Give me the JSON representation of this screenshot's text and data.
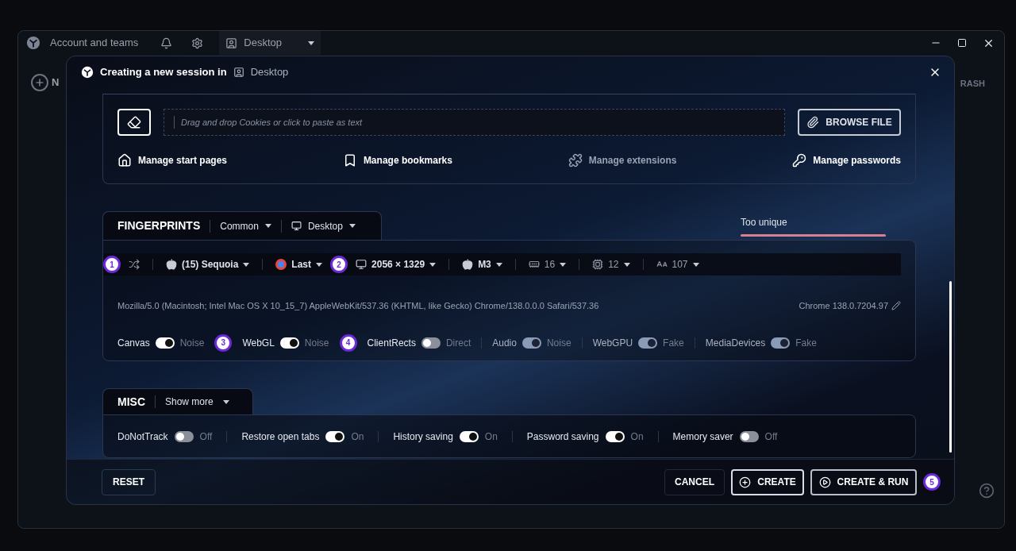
{
  "title_bar": {
    "account": "Account and teams",
    "workspace": "Desktop"
  },
  "sidebar": {
    "new_label": "N"
  },
  "right_panel": {
    "label": "RASH"
  },
  "dialog": {
    "title": "Creating a new session in",
    "workspace": "Desktop"
  },
  "cookies": {
    "placeholder": "Drag and drop Cookies or click to paste as text",
    "browse": "BROWSE FILE"
  },
  "manage_links": [
    {
      "kind": "home",
      "label": "Manage start pages",
      "disabled": false
    },
    {
      "kind": "bookmark",
      "label": "Manage bookmarks",
      "disabled": false
    },
    {
      "kind": "puzzle",
      "label": "Manage extensions",
      "disabled": true
    },
    {
      "kind": "key",
      "label": "Manage passwords",
      "disabled": false
    }
  ],
  "fingerprints": {
    "title": "FINGERPRINTS",
    "preset": "Common",
    "device": "Desktop",
    "score_label": "Too unique",
    "score": {
      "level": 1
    },
    "toolbar": [
      {
        "kind": "apple",
        "label": "(15) Sequoia"
      },
      {
        "kind": "chrome",
        "label": "Last"
      },
      {
        "kind": "monitor",
        "label": "2056 × 1329"
      },
      {
        "kind": "apple",
        "label": "M3"
      },
      {
        "kind": "memory",
        "label": "16"
      },
      {
        "kind": "cpu",
        "label": "12"
      },
      {
        "kind": "font",
        "label": "107"
      }
    ],
    "user_agent": "Mozilla/5.0 (Macintosh; Intel Mac OS X 10_15_7) AppleWebKit/537.36 (KHTML, like Gecko) Chrome/138.0.0.0 Safari/537.36",
    "browser_version": "Chrome 138.0.7204.97",
    "toggles": [
      {
        "label": "Canvas",
        "on": true,
        "disabled": false,
        "value": "Noise",
        "annotation": "3"
      },
      {
        "label": "WebGL",
        "on": true,
        "disabled": false,
        "value": "Noise",
        "annotation": "4"
      },
      {
        "label": "ClientRects",
        "on": false,
        "disabled": false,
        "value": "Direct"
      },
      {
        "label": "Audio",
        "on": true,
        "disabled": true,
        "value": "Noise"
      },
      {
        "label": "WebGPU",
        "on": true,
        "disabled": true,
        "value": "Fake"
      },
      {
        "label": "MediaDevices",
        "on": true,
        "disabled": true,
        "value": "Fake"
      }
    ]
  },
  "misc": {
    "title": "MISC",
    "show_more": "Show more",
    "toggles": [
      {
        "label": "DoNotTrack",
        "on": false,
        "value": "Off"
      },
      {
        "label": "Restore open tabs",
        "on": true,
        "value": "On"
      },
      {
        "label": "History saving",
        "on": true,
        "value": "On"
      },
      {
        "label": "Password saving",
        "on": true,
        "value": "On"
      },
      {
        "label": "Memory saver",
        "on": false,
        "value": "Off"
      }
    ]
  },
  "footer": {
    "reset": "RESET",
    "cancel": "CANCEL",
    "create": "CREATE",
    "create_run": "CREATE & RUN"
  },
  "annotations": [
    "1",
    "2",
    "5"
  ]
}
